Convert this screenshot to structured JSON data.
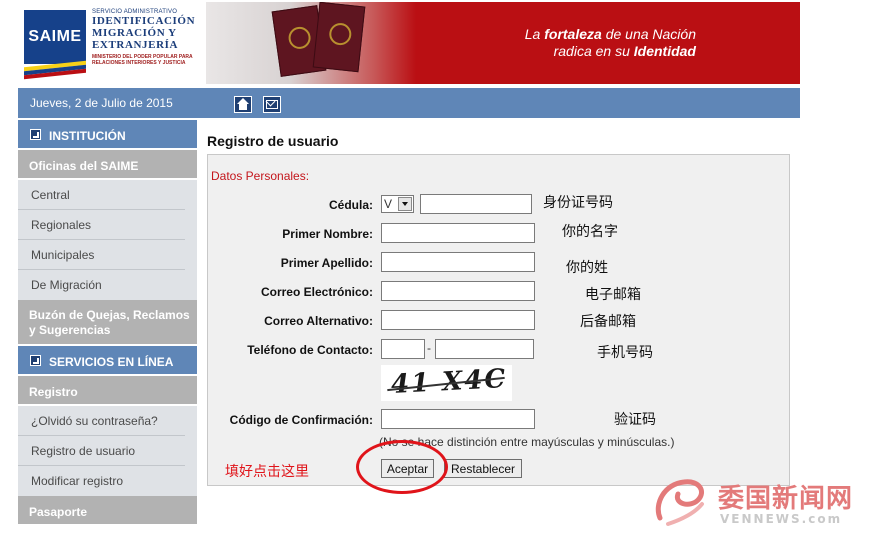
{
  "header": {
    "logo_badge": "SAIME",
    "logo_small": "SERVICIO ADMINISTRATIVO",
    "logo_line1": "IDENTIFICACIÓN",
    "logo_line2": "MIGRACIÓN Y",
    "logo_line3": "EXTRANJERÍA",
    "logo_ministry1": "MINISTERIO DEL PODER POPULAR PARA",
    "logo_ministry2": "RELACIONES INTERIORES Y JUSTICIA",
    "slogan_pre": "La ",
    "slogan_bold1": "fortaleza",
    "slogan_mid": " de una Nación",
    "slogan_line2_pre": "radica en su ",
    "slogan_bold2": "Identidad"
  },
  "topbar": {
    "date": "Jueves, 2 de Julio de 2015"
  },
  "sidebar": {
    "institucion": "INSTITUCIÓN",
    "oficinas": "Oficinas del SAIME",
    "oficinas_items": [
      "Central",
      "Regionales",
      "Municipales",
      "De Migración"
    ],
    "buzon": "Buzón de Quejas, Reclamos y Sugerencias",
    "servicios": "SERVICIOS EN LÍNEA",
    "registro": "Registro",
    "registro_items": [
      "¿Olvidó su contraseña?",
      "Registro de usuario",
      "Modificar registro"
    ],
    "pasaporte": "Pasaporte"
  },
  "main": {
    "title": "Registro de usuario",
    "section": "Datos Personales:",
    "labels": {
      "cedula": "Cédula:",
      "nombre": "Primer Nombre:",
      "apellido": "Primer Apellido:",
      "correo": "Correo Electrónico:",
      "correo_alt": "Correo Alternativo:",
      "telefono": "Teléfono de Contacto:",
      "codigo": "Código de Confirmación:"
    },
    "cedula_select": "V",
    "phone_dash": "-",
    "captcha_text": "41 X4C",
    "hint": "(No se hace distinción entre mayúsculas y minúsculas.)",
    "accept_button": "Aceptar",
    "reset_button": "Restablecer"
  },
  "annotations": {
    "cedula": "身份证号码",
    "nombre": "你的名字",
    "apellido": "你的姓",
    "correo": "电子邮箱",
    "correo_alt": "后备邮箱",
    "telefono": "手机号码",
    "codigo": "验证码",
    "click_here": "填好点击这里"
  },
  "watermark": {
    "zh": "委国新闻网",
    "en": "VENNEWS.com"
  },
  "colors": {
    "header_red": "#ba0f13",
    "nav_blue": "#5f86b7",
    "annotation_red": "#e0141a"
  }
}
